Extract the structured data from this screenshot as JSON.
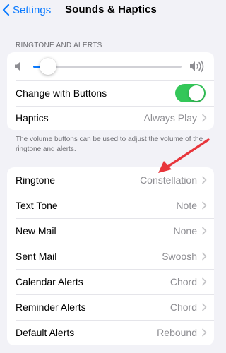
{
  "nav": {
    "back_label": "Settings",
    "title": "Sounds & Haptics"
  },
  "ringtone_alerts": {
    "header": "RINGTONE AND ALERTS",
    "volume_level": 0.1,
    "change_with_buttons": {
      "label": "Change with Buttons",
      "enabled": true
    },
    "haptics": {
      "label": "Haptics",
      "value": "Always Play"
    },
    "footer": "The volume buttons can be used to adjust the volume of the ringtone and alerts."
  },
  "sounds": [
    {
      "label": "Ringtone",
      "value": "Constellation"
    },
    {
      "label": "Text Tone",
      "value": "Note"
    },
    {
      "label": "New Mail",
      "value": "None"
    },
    {
      "label": "Sent Mail",
      "value": "Swoosh"
    },
    {
      "label": "Calendar Alerts",
      "value": "Chord"
    },
    {
      "label": "Reminder Alerts",
      "value": "Chord"
    },
    {
      "label": "Default Alerts",
      "value": "Rebound"
    }
  ],
  "colors": {
    "accent": "#0a7aff",
    "toggle_on": "#34c759",
    "annotation_arrow": "#e8353b",
    "secondary_text": "#8e8e93"
  },
  "icons": {
    "back": "chevron-left-icon",
    "volume_low": "speaker-icon",
    "volume_high": "speaker-wave-icon",
    "row_disclosure": "chevron-right-icon"
  }
}
